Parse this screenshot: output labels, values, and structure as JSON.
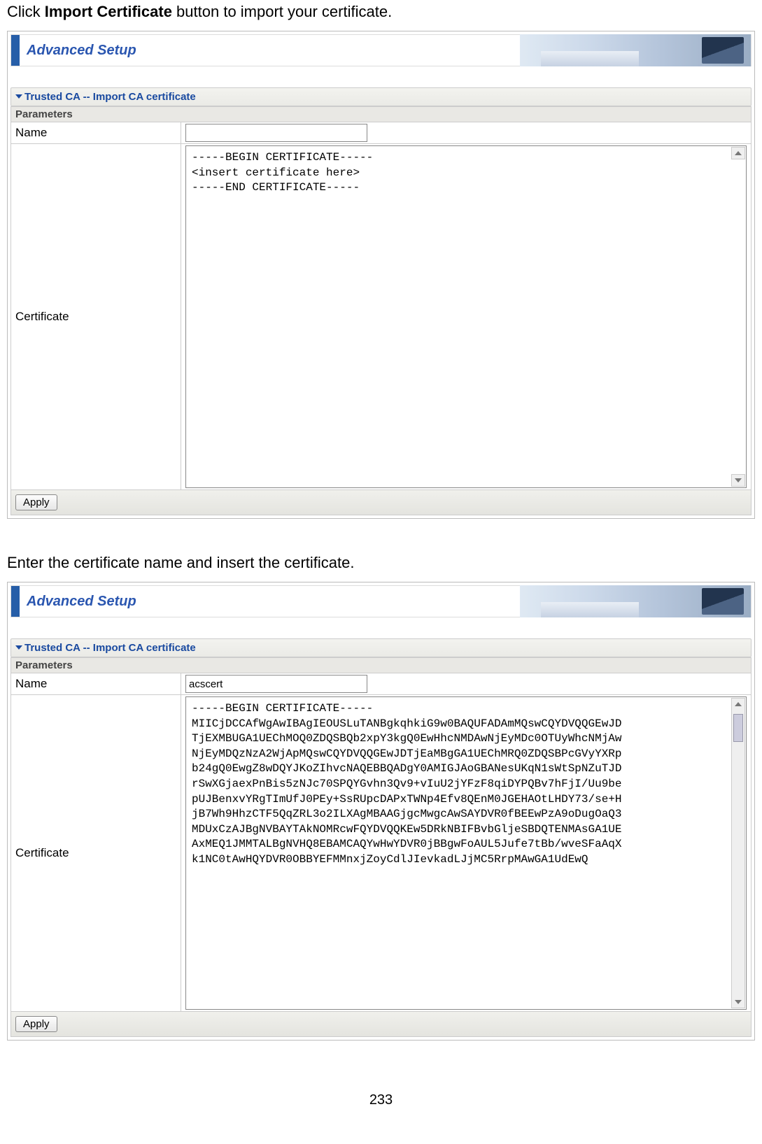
{
  "instruction1_pre": "Click ",
  "instruction1_bold": "Import Certificate",
  "instruction1_post": " button to import your certificate.",
  "instruction2": "Enter the certificate name and insert the certificate.",
  "header_title": "Advanced Setup",
  "section_title": "Trusted CA -- Import CA certificate",
  "params_label": "Parameters",
  "fields": {
    "name_label": "Name",
    "cert_label": "Certificate"
  },
  "screenshot1": {
    "name_value": "",
    "cert_value": "-----BEGIN CERTIFICATE-----\n<insert certificate here>\n-----END CERTIFICATE-----"
  },
  "screenshot2": {
    "name_value": "acscert",
    "cert_value": "-----BEGIN CERTIFICATE-----\nMIICjDCCAfWgAwIBAgIEOUSLuTANBgkqhkiG9w0BAQUFADAmMQswCQYDVQQGEwJD\nTjEXMBUGA1UEChMOQ0ZDQSBQb2xpY3kgQ0EwHhcNMDAwNjEyMDc0OTUyWhcNMjAw\nNjEyMDQzNzA2WjApMQswCQYDVQQGEwJDTjEaMBgGA1UEChMRQ0ZDQSBPcGVyYXRp\nb24gQ0EwgZ8wDQYJKoZIhvcNAQEBBQADgY0AMIGJAoGBANesUKqN1sWtSpNZuTJD\nrSwXGjaexPnBis5zNJc70SPQYGvhn3Qv9+vIuU2jYFzF8qiDYPQBv7hFjI/Uu9be\npUJBenxvYRgTImUfJ0PEy+SsRUpcDAPxTWNp4Efv8QEnM0JGEHAOtLHDY73/se+H\njB7Wh9HhzCTF5QqZRL3o2ILXAgMBAAGjgcMwgcAwSAYDVR0fBEEwPzA9oDugOaQ3\nMDUxCzAJBgNVBAYTAkNOMRcwFQYDVQQKEw5DRkNBIFBvbGljeSBDQTENMAsGA1UE\nAxMEQ1JMMTALBgNVHQ8EBAMCAQYwHwYDVR0jBBgwFoAUL5Jufe7tBb/wveSFaAqX\nk1NC0tAwHQYDVR0OBBYEFMMnxjZoyCdlJIevkadLJjMC5RrpMAwGA1UdEwQ"
  },
  "apply_label": "Apply",
  "page_number": "233"
}
